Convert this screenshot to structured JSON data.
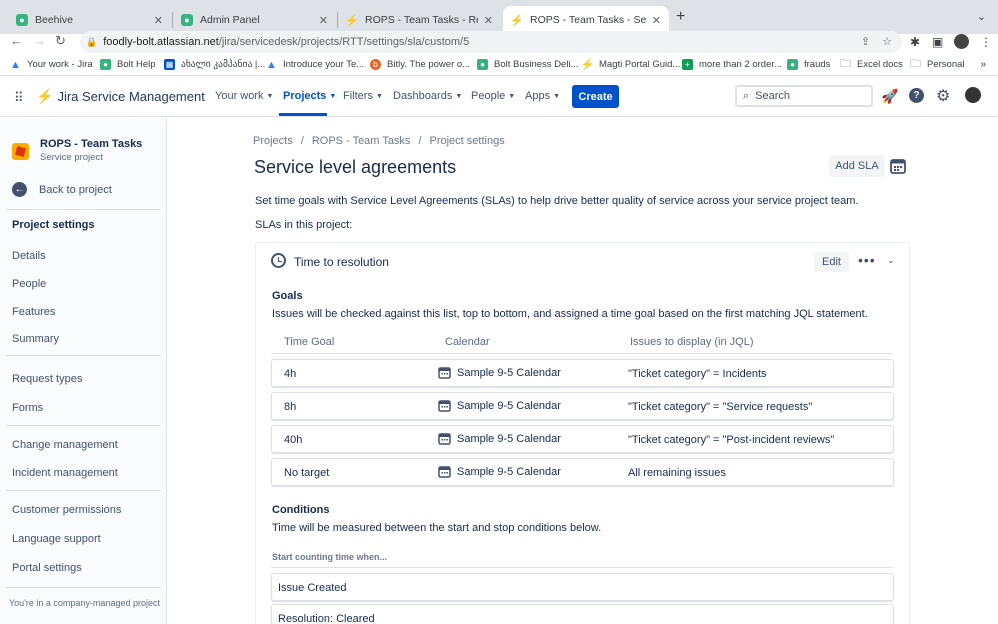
{
  "browser": {
    "tabs": [
      {
        "label": "Beehive",
        "active": false
      },
      {
        "label": "Admin Panel",
        "active": false
      },
      {
        "label": "ROPS - Team Tasks - Request t",
        "active": false
      },
      {
        "label": "ROPS - Team Tasks - Service l",
        "active": true
      }
    ],
    "url_host": "foodly-bolt.atlassian.net",
    "url_path": "/jira/servicedesk/projects/RTT/settings/sla/custom/5",
    "bookmarks": [
      "Your work - Jira",
      "Bolt Help",
      "ახალი კამპანია |...",
      "Introduce your Te...",
      "Bitly. The power o...",
      "Bolt Business Deli...",
      "Magti Portal Guid...",
      "more than 2 order...",
      "frauds",
      "Excel docs",
      "Personal"
    ]
  },
  "topnav": {
    "product": "Jira Service Management",
    "items": [
      "Your work",
      "Projects",
      "Filters",
      "Dashboards",
      "People",
      "Apps"
    ],
    "active_item": "Projects",
    "create_label": "Create",
    "search_placeholder": "Search"
  },
  "sidebar": {
    "project_name": "ROPS - Team Tasks",
    "project_type": "Service project",
    "back_label": "Back to project",
    "heading": "Project settings",
    "groups": [
      [
        "Details",
        "People",
        "Features",
        "Summary"
      ],
      [
        "Request types",
        "Forms"
      ],
      [
        "Change management",
        "Incident management"
      ],
      [
        "Customer permissions",
        "Language support",
        "Portal settings"
      ]
    ],
    "footer": "You're in a company-managed project"
  },
  "main": {
    "breadcrumb": [
      "Projects",
      "ROPS - Team Tasks",
      "Project settings"
    ],
    "title": "Service level agreements",
    "add_sla_label": "Add SLA",
    "intro": "Set time goals with Service Level Agreements (SLAs) to help drive better quality of service across your service project team.",
    "slas_label": "SLAs in this project:",
    "sla": {
      "title": "Time to resolution",
      "edit_label": "Edit",
      "goals_heading": "Goals",
      "goals_description": "Issues will be checked against this list, top to bottom, and assigned a time goal based on the first matching JQL statement.",
      "columns": [
        "Time Goal",
        "Calendar",
        "Issues to display (in JQL)"
      ],
      "goals": [
        {
          "time": "4h",
          "calendar": "Sample 9-5 Calendar",
          "jql": "\"Ticket category\" = Incidents"
        },
        {
          "time": "8h",
          "calendar": "Sample 9-5 Calendar",
          "jql": "\"Ticket category\" = \"Service requests\""
        },
        {
          "time": "40h",
          "calendar": "Sample 9-5 Calendar",
          "jql": "\"Ticket category\" = \"Post-incident reviews\""
        },
        {
          "time": "No target",
          "calendar": "Sample 9-5 Calendar",
          "jql": "All remaining issues"
        }
      ],
      "conditions_heading": "Conditions",
      "conditions_description": "Time will be measured between the start and stop conditions below.",
      "start_label": "Start counting time when...",
      "start_conditions": [
        "Issue Created",
        "Resolution: Cleared"
      ]
    }
  },
  "colors": {
    "brand": "#0052cc",
    "text": "#172b4d",
    "subtle": "#42526e"
  }
}
